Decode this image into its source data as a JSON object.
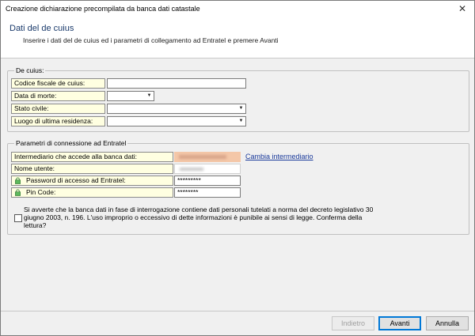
{
  "window": {
    "title": "Creazione dichiarazione precompilata da banca dati catastale"
  },
  "header": {
    "title": "Dati del de cuius",
    "subtitle": "Inserire i dati del de cuius ed i parametri di collegamento ad Entratel e premere Avanti"
  },
  "decuius": {
    "group_title": "De cuius:",
    "fields": [
      {
        "label": "Codice fiscale de cuius:",
        "value": ""
      },
      {
        "label": "Data di morte:",
        "value": ""
      },
      {
        "label": "Stato civile:",
        "value": ""
      },
      {
        "label": "Luogo di ultima residenza:",
        "value": ""
      }
    ]
  },
  "entratel": {
    "group_title": "Parametri di connessione ad Entratel",
    "intermediario_label": "Intermediario che accede alla banca dati:",
    "cambia_link": "Cambia intermediario",
    "nome_utente_label": "Nome utente:",
    "password_label": "Password di accesso ad Entratel:",
    "password_value": "*********",
    "pin_label": "Pin Code:",
    "pin_value": "********"
  },
  "warning": {
    "text": "Si avverte che la banca dati in fase di interrogazione contiene dati personali tutelati a norma del decreto legislativo 30 giugno 2003, n. 196. L'uso improprio o eccessivo di dette informazioni è punibile ai sensi di legge. Conferma della lettura?",
    "checked": false
  },
  "buttons": {
    "back": "Indietro",
    "next": "Avanti",
    "cancel": "Annulla"
  },
  "colors": {
    "label_bg": "#ffffe1",
    "header_title": "#1a3a6b",
    "link": "#1a3a9b",
    "redacted_bg": "#f4c7a8"
  }
}
